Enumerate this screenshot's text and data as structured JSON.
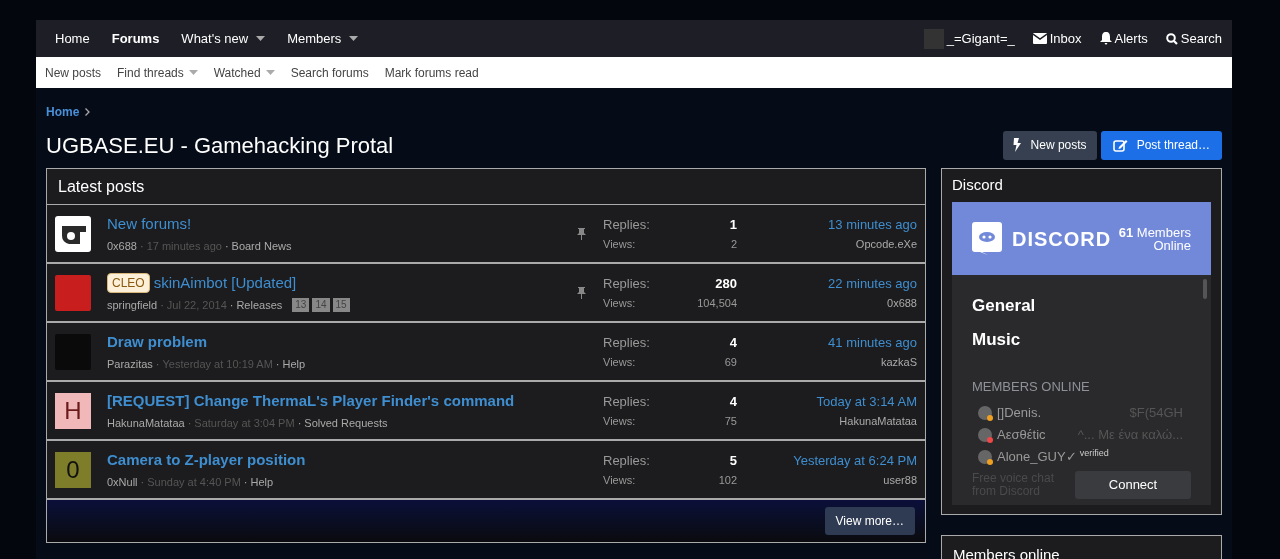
{
  "nav": {
    "items": [
      {
        "label": "Home",
        "selected": false,
        "dropdown": false
      },
      {
        "label": "Forums",
        "selected": true,
        "dropdown": false
      },
      {
        "label": "What's new",
        "selected": false,
        "dropdown": true
      },
      {
        "label": "Members",
        "selected": false,
        "dropdown": true
      }
    ],
    "user": "_=Gigant=_",
    "inbox": "Inbox",
    "alerts": "Alerts",
    "search": "Search"
  },
  "subnav": [
    {
      "label": "New posts",
      "dropdown": false
    },
    {
      "label": "Find threads",
      "dropdown": true
    },
    {
      "label": "Watched",
      "dropdown": true
    },
    {
      "label": "Search forums",
      "dropdown": false
    },
    {
      "label": "Mark forums read",
      "dropdown": false
    }
  ],
  "breadcrumb": [
    "Home"
  ],
  "page_title": "UGBASE.EU - Gamehacking Protal",
  "buttons": [
    {
      "kind": "secondary",
      "label": "New posts"
    },
    {
      "kind": "primary",
      "label": "Post thread…"
    }
  ],
  "latest_posts": {
    "title": "Latest posts",
    "view_more": "View more…",
    "threads": [
      {
        "avatar": {
          "kind": "logo"
        },
        "title": "New forums!",
        "unread": false,
        "pinned": true,
        "author": "0x688",
        "separators": [
          "·",
          "·"
        ],
        "time": "17 minutes ago",
        "forum": "Board News",
        "replies_label": "Replies:",
        "replies": "1",
        "views_label": "Views:",
        "views": "2",
        "last_time": "13 minutes ago",
        "last_user": "Opcode.eXe"
      },
      {
        "avatar": {
          "kind": "picture",
          "color": "#c81e1e"
        },
        "prefix": "CLEO",
        "title": "skinAimbot [Updated]",
        "unread": false,
        "pinned": true,
        "author": "springfield",
        "separators": [
          "·",
          "·"
        ],
        "time": "Jul 22, 2014",
        "forum": "Releases",
        "pages": [
          "13",
          "14",
          "15"
        ],
        "replies_label": "Replies:",
        "replies": "280",
        "views_label": "Views:",
        "views": "104,504",
        "last_time": "22 minutes ago",
        "last_user": "0x688"
      },
      {
        "avatar": {
          "kind": "picture",
          "color": "#0a0a0a"
        },
        "title": "Draw problem",
        "unread": true,
        "pinned": false,
        "author": "Parazitas",
        "separators": [
          "·",
          "·"
        ],
        "time": "Yesterday at 10:19 AM",
        "forum": "Help",
        "replies_label": "Replies:",
        "replies": "4",
        "views_label": "Views:",
        "views": "69",
        "last_time": "41 minutes ago",
        "last_user": "kazkaS"
      },
      {
        "avatar": {
          "kind": "letter",
          "letter": "H",
          "color": "#f0b8b8"
        },
        "title": "[REQUEST] Change ThermaL's Player Finder's command",
        "unread": true,
        "pinned": false,
        "author": "HakunaMatataa",
        "separators": [
          "·",
          "·"
        ],
        "time": "Saturday at 3:04 PM",
        "forum": "Solved Requests",
        "replies_label": "Replies:",
        "replies": "4",
        "views_label": "Views:",
        "views": "75",
        "last_time": "Today at 3:14 AM",
        "last_user": "HakunaMatataa"
      },
      {
        "avatar": {
          "kind": "letter",
          "letter": "0",
          "color": "#7e7e2a"
        },
        "title": "Camera to Z-player position",
        "unread": true,
        "pinned": false,
        "author": "0xNull",
        "separators": [
          "·",
          "·"
        ],
        "time": "Sunday at 4:40 PM",
        "forum": "Help",
        "replies_label": "Replies:",
        "replies": "5",
        "views_label": "Views:",
        "views": "102",
        "last_time": "Yesterday at 6:24 PM",
        "last_user": "user88"
      }
    ]
  },
  "discord": {
    "title": "Discord",
    "logo_text": "DISCORD",
    "count": "61",
    "count_label": "Members Online",
    "channels": [
      "General",
      "Music"
    ],
    "members_heading": "MEMBERS ONLINE",
    "members": [
      {
        "name": "[]Denis.",
        "game": "$F(54GH",
        "color": "#f0a020"
      },
      {
        "name": "Aεσθέtic",
        "game": "^... Με ένα καλώ...",
        "color": "#f04747"
      },
      {
        "name": "Alone_GUY✓",
        "game": "verified",
        "color": "#f0a020"
      }
    ],
    "footer": "Free voice chat from Discord",
    "connect": "Connect"
  },
  "members_online": {
    "title": "Members online"
  }
}
